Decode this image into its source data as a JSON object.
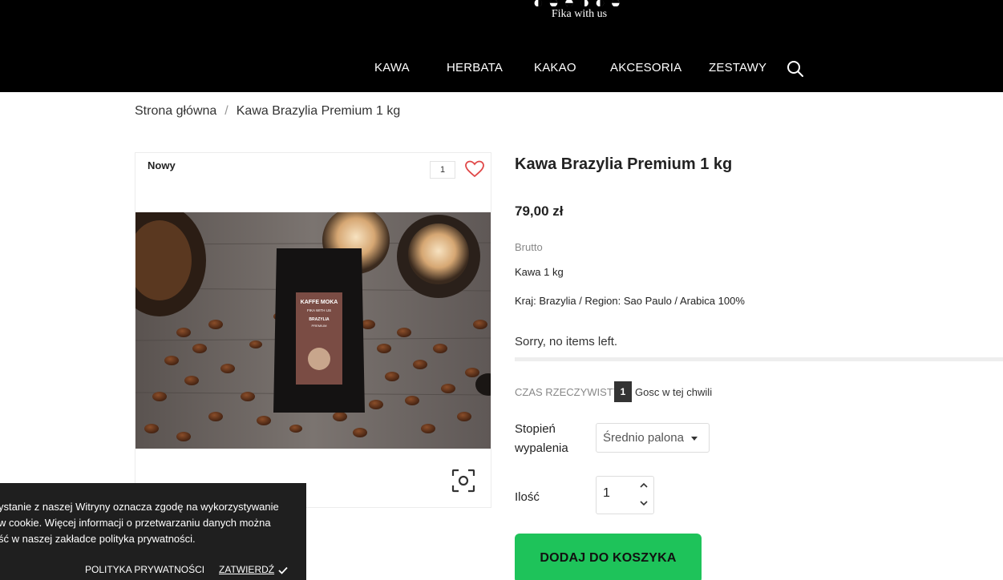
{
  "header": {
    "logo_tagline": "Fika with us",
    "nav": [
      "KAWA",
      "HERBATA",
      "KAKAO",
      "AKCESORIA",
      "ZESTAWY"
    ]
  },
  "breadcrumb": {
    "home": "Strona główna",
    "separator": "/",
    "current": "Kawa Brazylia Premium 1 kg"
  },
  "product_card": {
    "badge": "Nowy",
    "favorites_count": "1",
    "package_brand": "KAFFE MOKA",
    "package_tagline": "FIKA WITH US",
    "package_origin": "BRAZYLIA",
    "package_grade": "PREMIUM"
  },
  "product": {
    "title": "Kawa Brazylia Premium 1 kg",
    "price": "79,00 zł",
    "tax_label": "Brutto",
    "short_description": "Kawa 1 kg",
    "attributes": "Kraj: Brazylia / Region: Sao Paulo / Arabica 100%",
    "stock_message": "Sorry, no items left."
  },
  "realtime": {
    "label": "CZAS RZECZYWISTY:",
    "count": "1",
    "text": "Gosc w tej chwili"
  },
  "options": {
    "roast_label": "Stopień wypalenia",
    "roast_value": "Średnio palona",
    "qty_label": "Ilość",
    "qty_value": "1"
  },
  "cart": {
    "add_label": "DODAJ DO KOSZYKA"
  },
  "cookie": {
    "text": "ystanie z naszej Witryny oznacza zgodę na wykorzystywanie\nw cookie. Więcej informacji o przetwarzaniu danych można\nść w naszej zakładce polityka prywatności.",
    "policy_label": "POLITYKA PRYWATNOŚCI",
    "confirm_label": "ZATWIERDŹ"
  },
  "colors": {
    "header_bg": "#000000",
    "add_to_cart": "#1ec35a",
    "heart": "#e04848",
    "cookie_bg": "#1f1f1f"
  }
}
